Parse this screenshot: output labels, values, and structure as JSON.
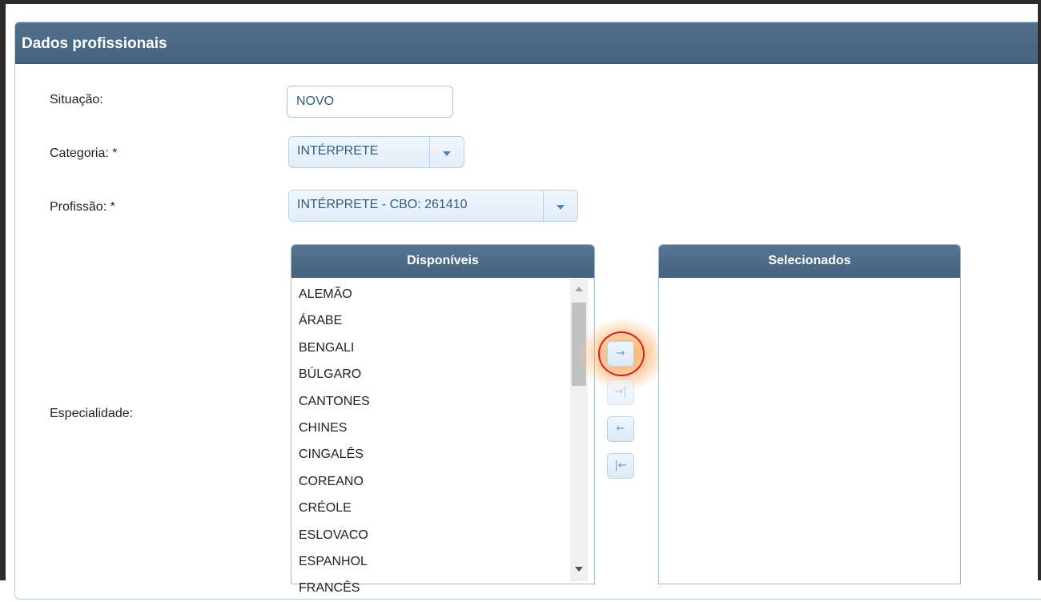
{
  "panel": {
    "title": "Dados profissionais"
  },
  "form": {
    "situacao": {
      "label": "Situação:",
      "value": "NOVO"
    },
    "categoria": {
      "label": "Categoria: *",
      "value": "INTÉRPRETE"
    },
    "profissao": {
      "label": "Profissão: *",
      "value": "INTÉRPRETE - CBO: 261410"
    },
    "especialidade": {
      "label": "Especialidade:"
    }
  },
  "picklist": {
    "available_header": "Disponíveis",
    "selected_header": "Selecionados",
    "available_items": [
      "ALEMÃO",
      "ÁRABE",
      "BENGALI",
      "BÚLGARO",
      "CANTONES",
      "CHINES",
      "CINGALÊS",
      "COREANO",
      "CRÉOLE",
      "ESLOVACO",
      "ESPANHOL",
      "FRANCÊS"
    ],
    "selected_items": [],
    "buttons": {
      "add": {
        "icon": "arrow-right-icon",
        "glyph": "→",
        "highlighted": true
      },
      "add_all": {
        "icon": "arrow-right-to-bar-icon",
        "glyph": "→|"
      },
      "remove": {
        "icon": "arrow-left-icon",
        "glyph": "←"
      },
      "remove_all": {
        "icon": "arrow-left-from-bar-icon",
        "glyph": "|←"
      }
    }
  },
  "colors": {
    "header": "#45637f",
    "field_text": "#2e5d8a",
    "highlight_ring": "#e01a1a",
    "highlight_glow": "#ff9640"
  }
}
